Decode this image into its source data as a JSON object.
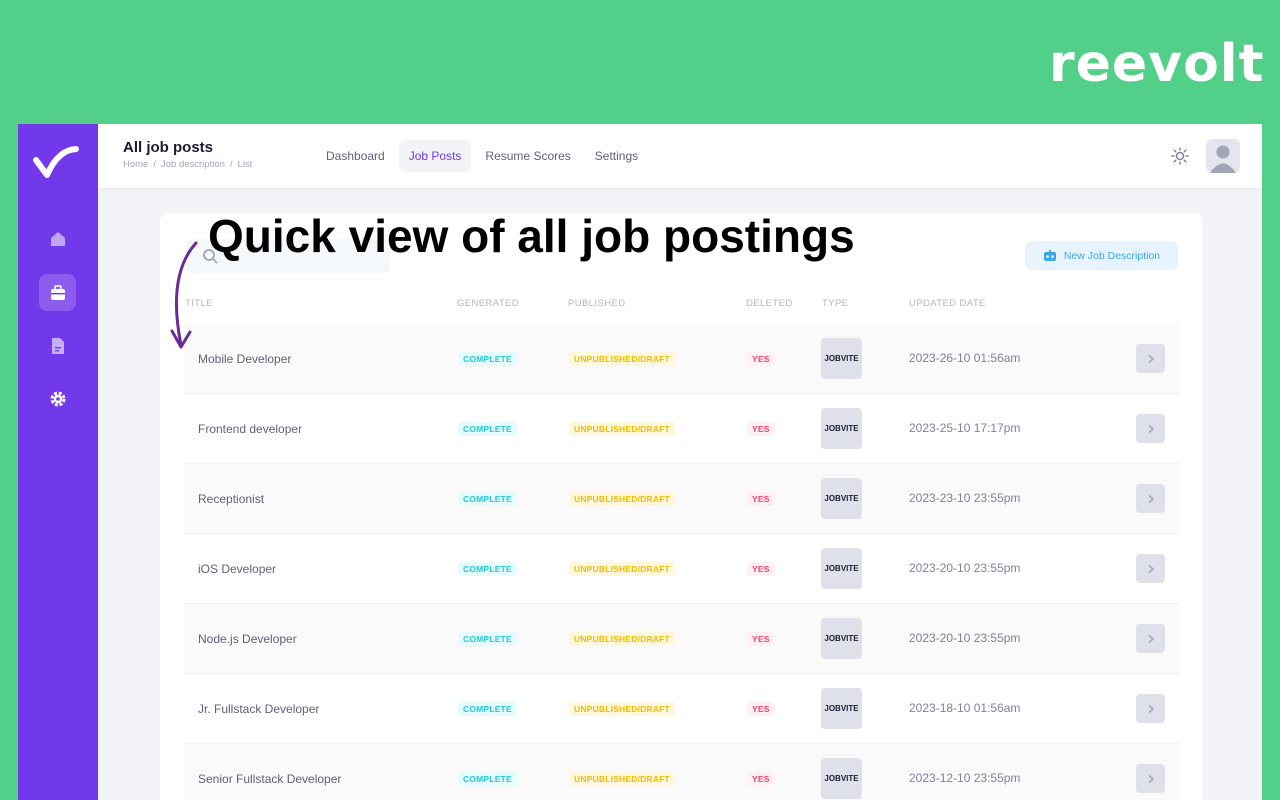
{
  "brand": {
    "name": "reevolt",
    "bg_color": "#52cf89"
  },
  "annotation": {
    "text": "Quick view of all job postings"
  },
  "sidebar": {
    "color": "#7239ea",
    "items": [
      {
        "icon": "home-icon",
        "active": false
      },
      {
        "icon": "briefcase-icon",
        "active": true
      },
      {
        "icon": "document-icon",
        "active": false
      },
      {
        "icon": "gear-icon",
        "active": false
      }
    ]
  },
  "header": {
    "title": "All job posts",
    "breadcrumbs": [
      "Home",
      "Job description",
      "List"
    ],
    "tabs": [
      {
        "label": "Dashboard",
        "active": false
      },
      {
        "label": "Job Posts",
        "active": true
      },
      {
        "label": "Resume Scores",
        "active": false
      },
      {
        "label": "Settings",
        "active": false
      }
    ],
    "theme_icon": "sun-icon",
    "avatar_icon": "user-avatar-icon"
  },
  "toolbar": {
    "search_placeholder": "",
    "new_button_label": "New Job Description"
  },
  "table": {
    "columns": [
      "TITLE",
      "GENERATED",
      "PUBLISHED",
      "DELETED",
      "TYPE",
      "UPDATED DATE"
    ],
    "rows": [
      {
        "title": "Mobile Developer",
        "generated": "COMPLETE",
        "published": "UNPUBLISHED/DRAFT",
        "deleted": "YES",
        "type": "JOBVITE",
        "updated": "2023-26-10 01:56am"
      },
      {
        "title": "Frontend developer",
        "generated": "COMPLETE",
        "published": "UNPUBLISHED/DRAFT",
        "deleted": "YES",
        "type": "JOBVITE",
        "updated": "2023-25-10 17:17pm"
      },
      {
        "title": "Receptionist",
        "generated": "COMPLETE",
        "published": "UNPUBLISHED/DRAFT",
        "deleted": "YES",
        "type": "JOBVITE",
        "updated": "2023-23-10 23:55pm"
      },
      {
        "title": "iOS Developer",
        "generated": "COMPLETE",
        "published": "UNPUBLISHED/DRAFT",
        "deleted": "YES",
        "type": "JOBVITE",
        "updated": "2023-20-10 23:55pm"
      },
      {
        "title": "Node.js Developer",
        "generated": "COMPLETE",
        "published": "UNPUBLISHED/DRAFT",
        "deleted": "YES",
        "type": "JOBVITE",
        "updated": "2023-20-10 23:55pm"
      },
      {
        "title": "Jr. Fullstack Developer",
        "generated": "COMPLETE",
        "published": "UNPUBLISHED/DRAFT",
        "deleted": "YES",
        "type": "JOBVITE",
        "updated": "2023-18-10 01:56am"
      },
      {
        "title": "Senior Fullstack Developer",
        "generated": "COMPLETE",
        "published": "UNPUBLISHED/DRAFT",
        "deleted": "YES",
        "type": "JOBVITE",
        "updated": "2023-12-10 23:55pm"
      }
    ]
  }
}
